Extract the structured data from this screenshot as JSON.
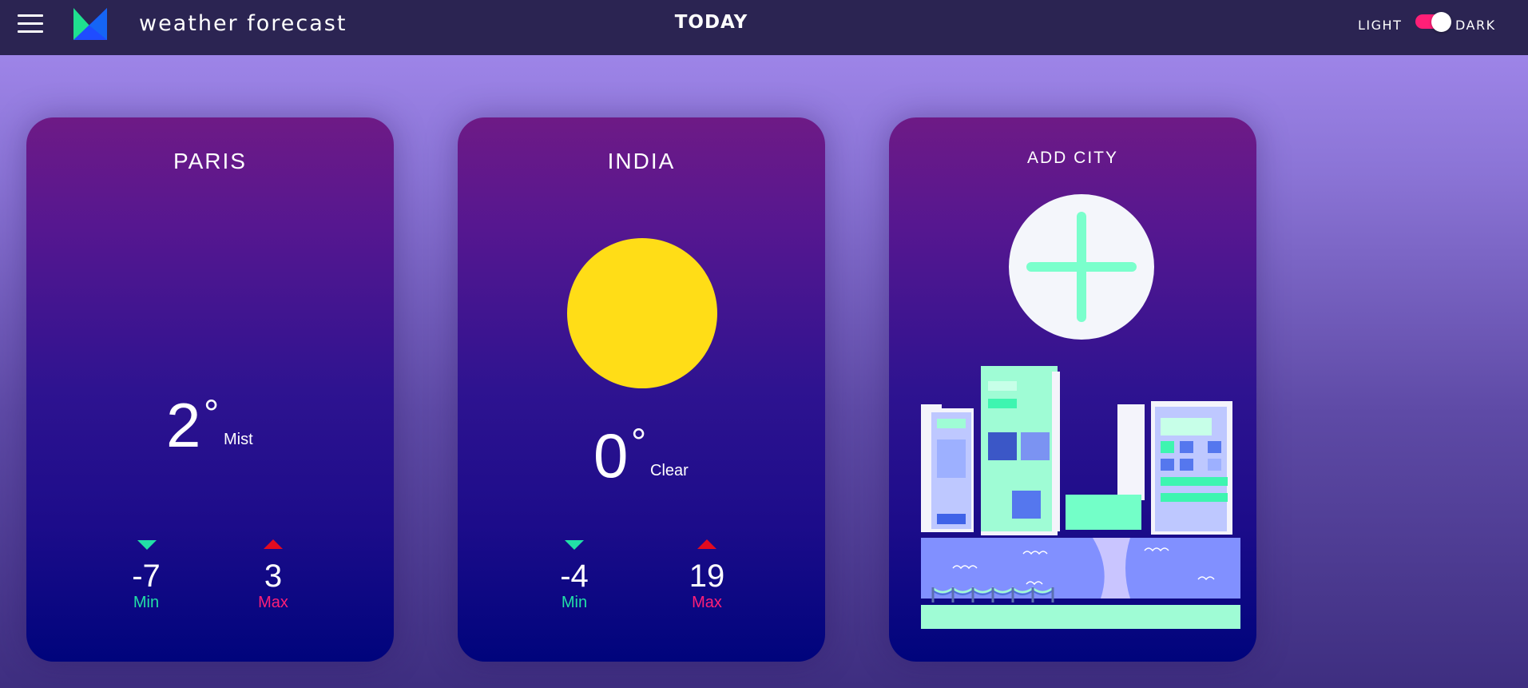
{
  "header": {
    "app_title": "weather forecast",
    "center_title": "TODAY",
    "theme_light_label": "LIGHT",
    "theme_dark_label": "DARK",
    "theme_mode": "dark"
  },
  "cards": [
    {
      "city": "PARIS",
      "temp": "2",
      "deg": "°",
      "condition": "Mist",
      "min": "-7",
      "min_label": "Min",
      "max": "3",
      "max_label": "Max",
      "icon": "none"
    },
    {
      "city": "INDIA",
      "temp": "0",
      "deg": "°",
      "condition": "Clear",
      "min": "-4",
      "min_label": "Min",
      "max": "19",
      "max_label": "Max",
      "icon": "sun-icon"
    }
  ],
  "add_city": {
    "label": "ADD CITY",
    "icon": "plus-icon",
    "illustration": "city-skyline-illustration"
  },
  "colors": {
    "header_bg": "#2b2452",
    "min_accent": "#22e0a6",
    "max_accent": "#ff1f77",
    "max_arrow": "#e30b1f",
    "sun": "#ffdd17",
    "toggle": "#ff1f77"
  }
}
